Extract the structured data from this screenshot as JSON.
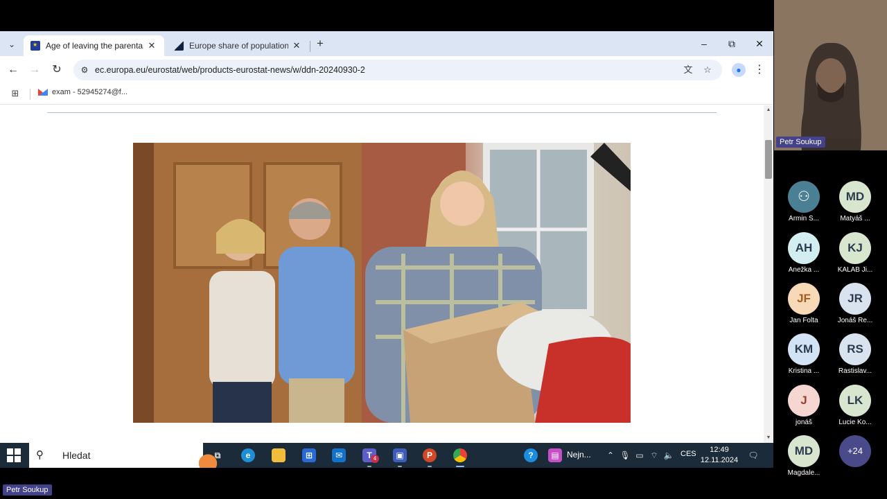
{
  "browser": {
    "tabs": [
      {
        "title": "Age of leaving the parental hon",
        "active": true
      },
      {
        "title": "Europe share of population with",
        "active": false
      }
    ],
    "new_tab_label": "+",
    "window_controls": {
      "minimize": "–",
      "maximize": "⧉",
      "close": "✕"
    },
    "url": "ec.europa.eu/eurostat/web/products-eurostat-news/w/ddn-20240930-2",
    "bookmarks": [
      {
        "label": "exam - 52945274@f..."
      }
    ]
  },
  "taskbar": {
    "search_placeholder": "Hledat",
    "teams_badge": "4",
    "news_label": "Nejn...",
    "language": "CES",
    "time": "12:49",
    "date": "12.11.2024"
  },
  "meeting": {
    "speaker_name": "Petr Soukup",
    "bottom_name": "Petr Soukup",
    "participants": [
      {
        "initials": "",
        "name": "Armin S...",
        "color": "#4a7f94",
        "icon": "person-icon"
      },
      {
        "initials": "MD",
        "name": "Matyáš ...",
        "color": "#d9e6cf"
      },
      {
        "initials": "AH",
        "name": "Anežka ...",
        "color": "#d2eef0"
      },
      {
        "initials": "KJ",
        "name": "KALAB Ji...",
        "color": "#d9e6cf"
      },
      {
        "initials": "JF",
        "name": "Jan Folta",
        "color": "#f7d9b8"
      },
      {
        "initials": "JR",
        "name": "Jonáš Re...",
        "color": "#d9e3f0"
      },
      {
        "initials": "KM",
        "name": "Kristina ...",
        "color": "#d2e3f5"
      },
      {
        "initials": "RS",
        "name": "Rastislav...",
        "color": "#d9e3f0"
      },
      {
        "initials": "J",
        "name": "jonáš",
        "color": "#f6d6d0"
      },
      {
        "initials": "LK",
        "name": "Lucie Ko...",
        "color": "#d9e6cf"
      },
      {
        "initials": "MD",
        "name": "Magdale...",
        "color": "#d9e6cf"
      }
    ],
    "more_count": "+24"
  }
}
